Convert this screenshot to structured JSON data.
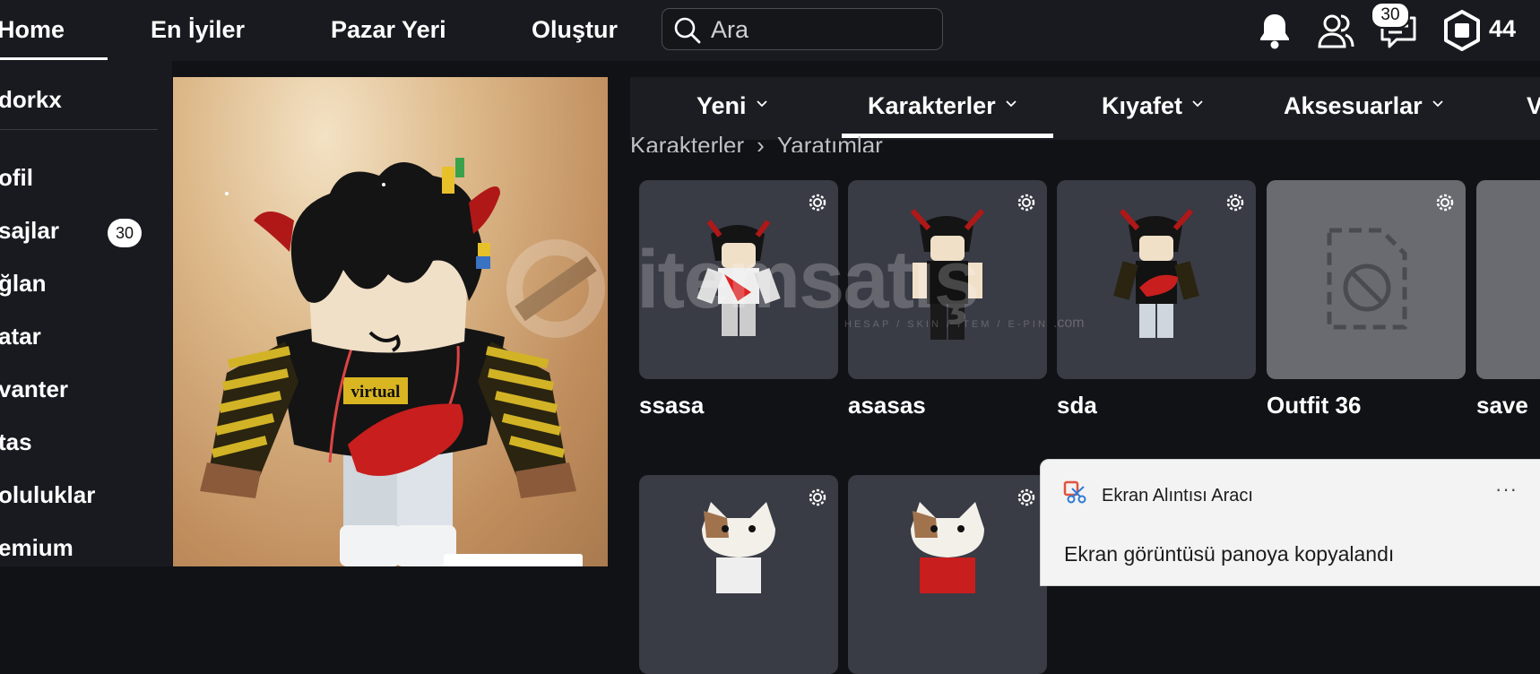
{
  "nav": {
    "home": "Home",
    "top": "En İyiler",
    "market": "Pazar Yeri",
    "create": "Oluştur"
  },
  "search": {
    "placeholder": "Ara"
  },
  "header": {
    "messages_badge": "30",
    "robux": "44"
  },
  "sidebar": {
    "username": "dorkx",
    "messages_badge": "30",
    "items": [
      {
        "label": "ofil"
      },
      {
        "label": "sajlar"
      },
      {
        "label": "ğlan"
      },
      {
        "label": "atar"
      },
      {
        "label": "vanter"
      },
      {
        "label": "tas"
      },
      {
        "label": "oluluklar"
      },
      {
        "label": "emium"
      }
    ]
  },
  "avatar": {
    "shirt_text": "virtual"
  },
  "categories": {
    "tabs": [
      {
        "label": "Yeni"
      },
      {
        "label": "Karakterler"
      },
      {
        "label": "Kıyafet"
      },
      {
        "label": "Aksesuarlar"
      },
      {
        "label": "V"
      }
    ],
    "active": "Karakterler"
  },
  "breadcrumb": {
    "parent": "Karakterler",
    "current": "Yaratımlar"
  },
  "outfits": [
    {
      "name": "ssasa"
    },
    {
      "name": "asasas"
    },
    {
      "name": "sda"
    },
    {
      "name": "Outfit 36"
    },
    {
      "name": "save"
    }
  ],
  "watermark": {
    "text": "itemsatış",
    "sub": "HESAP / SKIN / ITEM / E-PIN",
    "domain": ".com"
  },
  "toast": {
    "title": "Ekran Alıntısı Aracı",
    "more": "···",
    "message": "Ekran görüntüsü panoya kopyalandı"
  },
  "colors": {
    "background": "#111216",
    "bar": "#191a1f",
    "card": "#393b45",
    "toast": "#f3f3f3"
  }
}
